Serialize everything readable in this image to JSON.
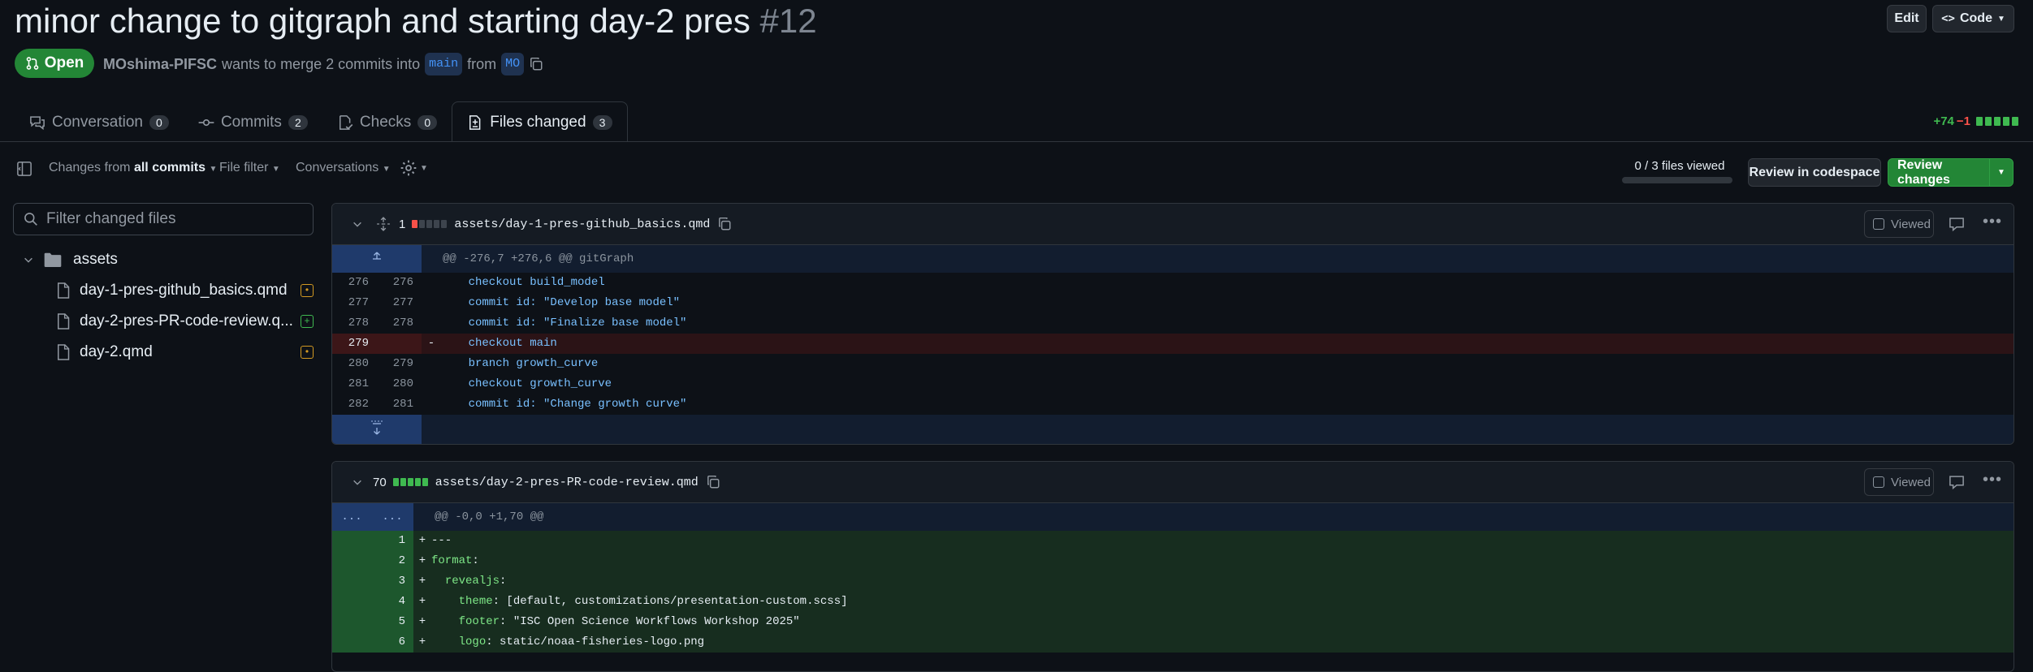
{
  "pr": {
    "title": "minor change to gitgraph and starting day-2 pres",
    "number": "#12",
    "state": "Open",
    "author": "MOshima-PIFSC",
    "meta_text": "wants to merge 2 commits into",
    "base_branch": "main",
    "from_text": "from",
    "head_branch": "MO"
  },
  "header": {
    "edit_label": "Edit",
    "code_label": "Code"
  },
  "tabs": [
    {
      "label": "Conversation",
      "count": "0"
    },
    {
      "label": "Commits",
      "count": "2"
    },
    {
      "label": "Checks",
      "count": "0"
    },
    {
      "label": "Files changed",
      "count": "3"
    }
  ],
  "diffstat": {
    "additions": "+74",
    "deletions": "−1"
  },
  "toolbar": {
    "changes_from_prefix": "Changes from",
    "changes_from_value": "all commits",
    "file_filter": "File filter",
    "conversations": "Conversations",
    "files_viewed": "0 / 3 files viewed",
    "files_viewed_progress": 0,
    "review_codespace": "Review in codespace",
    "review_changes": "Review changes"
  },
  "sidebar": {
    "filter_placeholder": "Filter changed files",
    "folder": "assets",
    "files": [
      {
        "name": "day-1-pres-github_basics.qmd",
        "status": "modified"
      },
      {
        "name": "day-2-pres-PR-code-review.q...",
        "status": "added"
      },
      {
        "name": "day-2.qmd",
        "status": "modified"
      }
    ]
  },
  "diff_files": [
    {
      "changes": "1",
      "path": "assets/day-1-pres-github_basics.qmd",
      "viewed_label": "Viewed",
      "hunk": "@@ -276,7 +276,6 @@ gitGraph",
      "lines": [
        {
          "old": "276",
          "new": "276",
          "type": "ctx",
          "sign": " ",
          "text": "    checkout build_model"
        },
        {
          "old": "277",
          "new": "277",
          "type": "ctx",
          "sign": " ",
          "text": "    commit id: \"Develop base model\""
        },
        {
          "old": "278",
          "new": "278",
          "type": "ctx",
          "sign": " ",
          "text": "    commit id: \"Finalize base model\""
        },
        {
          "old": "279",
          "new": "",
          "type": "del",
          "sign": "-",
          "text": "    checkout main"
        },
        {
          "old": "280",
          "new": "279",
          "type": "ctx",
          "sign": " ",
          "text": "    branch growth_curve"
        },
        {
          "old": "281",
          "new": "280",
          "type": "ctx",
          "sign": " ",
          "text": "    checkout growth_curve"
        },
        {
          "old": "282",
          "new": "281",
          "type": "ctx",
          "sign": " ",
          "text": "    commit id: \"Change growth curve\""
        }
      ]
    },
    {
      "changes": "70",
      "path": "assets/day-2-pres-PR-code-review.qmd",
      "viewed_label": "Viewed",
      "hunk_gutter": "...",
      "hunk": "@@ -0,0 +1,70 @@",
      "lines": [
        {
          "new": "1",
          "sign": "+",
          "text": "---"
        },
        {
          "new": "2",
          "sign": "+",
          "text": "format:"
        },
        {
          "new": "3",
          "sign": "+",
          "text": "  revealjs:"
        },
        {
          "new": "4",
          "sign": "+",
          "text": "    theme: [default, customizations/presentation-custom.scss]"
        },
        {
          "new": "5",
          "sign": "+",
          "text": "    footer: \"ISC Open Science Workflows Workshop 2025\""
        },
        {
          "new": "6",
          "sign": "+",
          "text": "    logo: static/noaa-fisheries-logo.png"
        }
      ]
    }
  ],
  "colors": {
    "bg": "#0d1117",
    "accent_green": "#238636",
    "link_blue": "#4493f8",
    "deleted_red": "#f85149",
    "added_green": "#3fb950"
  }
}
